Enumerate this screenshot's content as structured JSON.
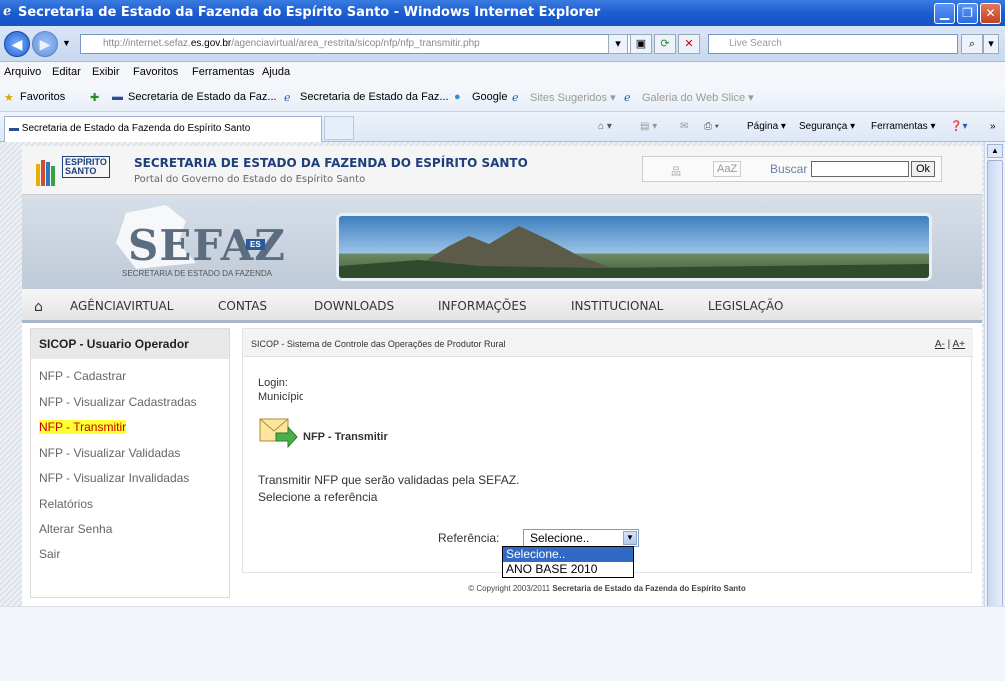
{
  "window": {
    "title": "Secretaria de Estado da Fazenda do Espírito Santo - Windows Internet Explorer"
  },
  "address": {
    "url_prefix": "http://internet.sefaz.",
    "url_domain": "es.gov.br",
    "url_path": "/agenciavirtual/area_restrita/sicop/nfp/nfp_transmitir.php",
    "search_placeholder": "Live Search"
  },
  "menu": [
    "Arquivo",
    "Editar",
    "Exibir",
    "Favoritos",
    "Ferramentas",
    "Ajuda"
  ],
  "favorites": {
    "label": "Favoritos",
    "items": [
      "Secretaria de Estado da Faz...",
      "Secretaria de Estado da Faz...",
      "Google",
      "Sites Sugeridos ▾",
      "Galeria do Web Slice ▾"
    ]
  },
  "tab": {
    "title": "Secretaria de Estado da Fazenda do Espírito Santo"
  },
  "commands": [
    "Página ▾",
    "Segurança ▾",
    "Ferramentas ▾"
  ],
  "site": {
    "logo_text": "ESPÍRITO SANTO",
    "title": "SECRETARIA DE ESTADO DA FAZENDA DO ESPÍRITO SANTO",
    "subtitle": "Portal do Governo do Estado do Espírito Santo",
    "tools": {
      "font_label": "AaZ",
      "search_label": "Buscar",
      "ok_label": "Ok"
    },
    "brand": "SEFAZ",
    "brand_badge": "ES",
    "brand_sub": "SECRETARIA DE ESTADO DA FAZENDA",
    "nav": [
      "AGÊNCIAVIRTUAL",
      "CONTAS",
      "DOWNLOADS",
      "INFORMAÇÕES",
      "INSTITUCIONAL",
      "LEGISLAÇÃO"
    ]
  },
  "sidebar": {
    "header": "SICOP - Usuario Operador",
    "items": [
      "NFP - Cadastrar",
      "NFP - Visualizar Cadastradas",
      "NFP - Transmitir",
      "NFP - Visualizar Validadas",
      "NFP - Visualizar Invalidadas",
      "Relatórios",
      "Alterar Senha",
      "Sair"
    ]
  },
  "main": {
    "breadcrumb": "SICOP - Sistema de Controle das Operações de Produtor Rural",
    "font_smaller": "A-",
    "font_larger": "A+",
    "login_label": "Login:",
    "municipio_label": "Município:",
    "page_title": "NFP - Transmitir",
    "desc1": "Transmitir NFP que serão validadas pela SEFAZ.",
    "desc2": "Selecione a referência",
    "ref_label": "Referência:",
    "ref_selected": "Selecione..",
    "ref_options": [
      "Selecione..",
      "ANO BASE 2010"
    ]
  },
  "footer": {
    "copyright_prefix": "© Copyright 2003/2011",
    "copyright_org": "Secretaria de Estado da Fazenda do Espírito Santo"
  }
}
